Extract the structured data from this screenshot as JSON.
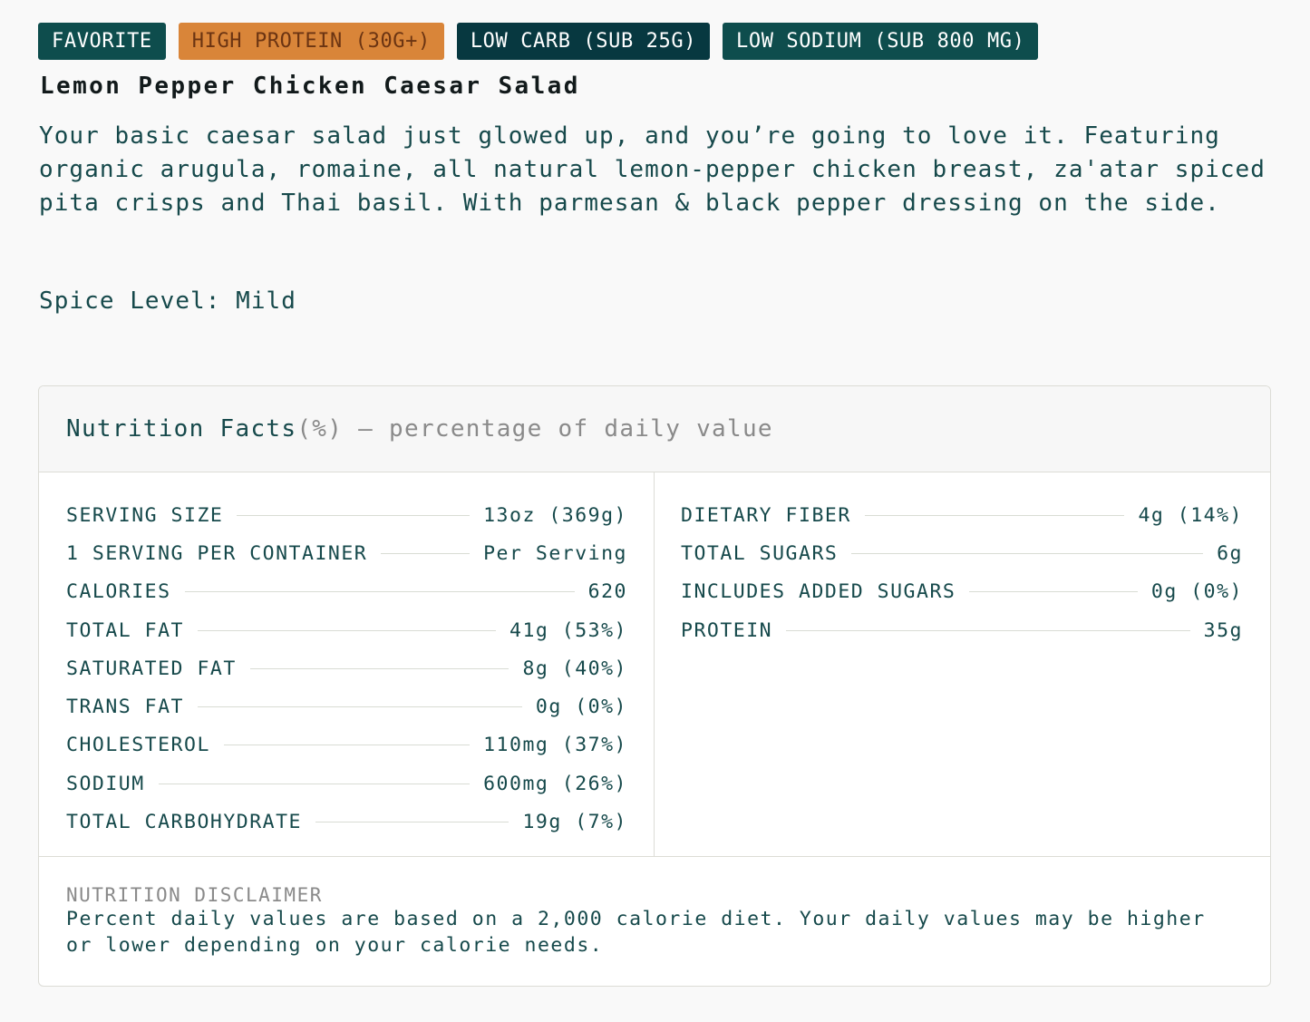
{
  "tags": [
    {
      "label": "FAVORITE"
    },
    {
      "label": "HIGH PROTEIN (30G+)"
    },
    {
      "label": "LOW CARB (SUB 25G)"
    },
    {
      "label": "LOW SODIUM (SUB 800 MG)"
    }
  ],
  "colors": {
    "teal": "#0e4d4d",
    "dark_teal": "#073840",
    "orange": "#d98539",
    "text": "#16494b"
  },
  "product": {
    "title": "Lemon Pepper Chicken Caesar Salad",
    "description": "Your basic caesar salad just glowed up, and you’re going to love it. Featuring organic arugula, romaine, all natural lemon-pepper chicken breast, za'atar spiced pita crisps and Thai basil. With parmesan & black pepper dressing on the side.",
    "spice_level": "Spice Level: Mild"
  },
  "nutrition": {
    "header_title": "Nutrition Facts",
    "header_subtitle": " (%) – percentage of daily value",
    "left": [
      {
        "label": "SERVING SIZE",
        "value": "13oz (369g)"
      },
      {
        "label": "1 SERVING PER CONTAINER",
        "value": "Per Serving"
      },
      {
        "label": "CALORIES",
        "value": "620"
      },
      {
        "label": "TOTAL FAT",
        "value": "41g (53%)"
      },
      {
        "label": "SATURATED FAT",
        "value": "8g (40%)"
      },
      {
        "label": "TRANS FAT",
        "value": "0g (0%)"
      },
      {
        "label": "CHOLESTEROL",
        "value": "110mg (37%)"
      },
      {
        "label": "SODIUM",
        "value": "600mg (26%)"
      },
      {
        "label": "TOTAL CARBOHYDRATE",
        "value": "19g (7%)"
      }
    ],
    "right": [
      {
        "label": "DIETARY FIBER",
        "value": "4g (14%)"
      },
      {
        "label": "TOTAL SUGARS",
        "value": "6g"
      },
      {
        "label": "INCLUDES ADDED SUGARS",
        "value": "0g (0%)"
      },
      {
        "label": "PROTEIN",
        "value": "35g"
      }
    ],
    "disclaimer_title": "NUTRITION DISCLAIMER",
    "disclaimer_text": "Percent daily values are based on a 2,000 calorie diet. Your daily values may be higher or lower depending on your calorie needs."
  }
}
